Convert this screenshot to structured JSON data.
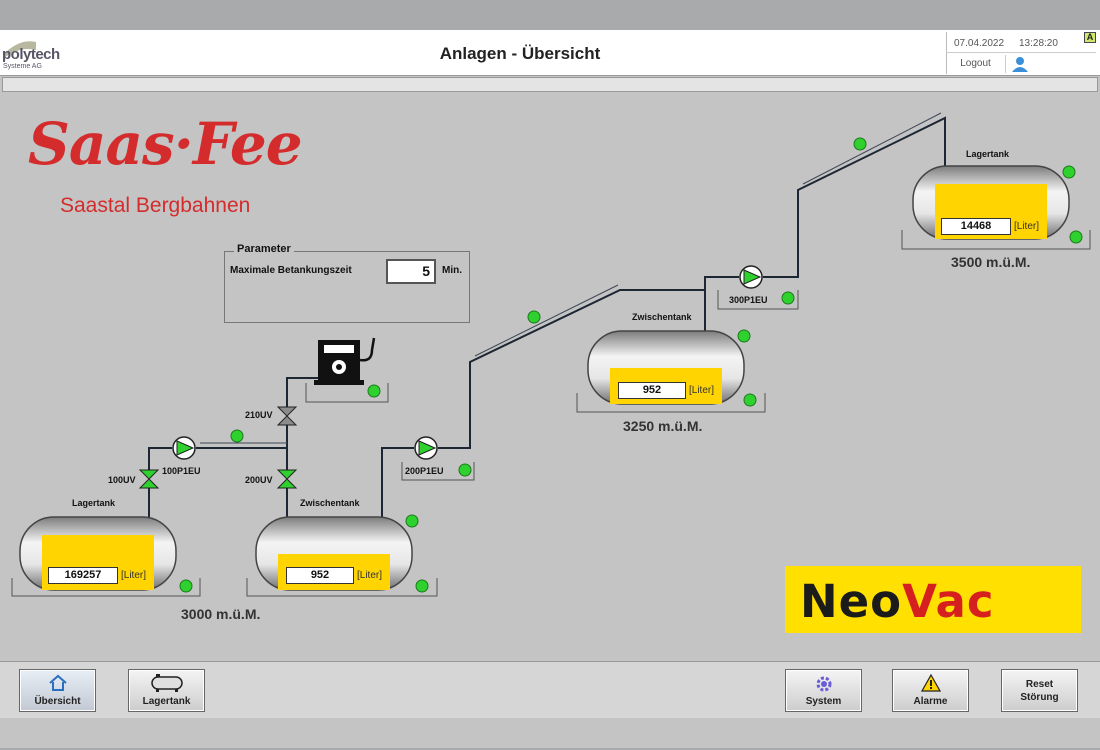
{
  "header": {
    "logo_text": "polytech",
    "logo_sub": "Systeme AG",
    "title": "Anlagen - Übersicht",
    "date": "07.04.2022",
    "time": "13:28:20",
    "badge": "A",
    "logout_label": "Logout"
  },
  "brand": {
    "saasfee": "Saas·Fee",
    "saasfee_sub": "Saastal Bergbahnen",
    "neovac_part1": "Neo",
    "neovac_part2": "Vac"
  },
  "parameter": {
    "legend": "Parameter",
    "label": "Maximale Betankungszeit",
    "value": "5",
    "unit": "Min."
  },
  "tanks": [
    {
      "name": "Lagertank",
      "value": "169257",
      "unit": "[Liter]"
    },
    {
      "name": "Zwischentank",
      "value": "952",
      "unit": "[Liter]"
    },
    {
      "name": "Zwischentank",
      "value": "952",
      "unit": "[Liter]"
    },
    {
      "name": "Lagertank",
      "value": "14468",
      "unit": "[Liter]"
    }
  ],
  "valves": {
    "v100": "100UV",
    "v200": "200UV",
    "v210": "210UV"
  },
  "pumps": {
    "p100": "100P1EU",
    "p200": "200P1EU",
    "p300": "300P1EU"
  },
  "elevations": {
    "e3000": "3000 m.ü.M.",
    "e3250": "3250 m.ü.M.",
    "e3500": "3500 m.ü.M."
  },
  "footer": {
    "overview": "Übersicht",
    "lagertank": "Lagertank",
    "system": "System",
    "alarme": "Alarme",
    "reset_line1": "Reset",
    "reset_line2": "Störung"
  },
  "colors": {
    "status_ok": "#2ed12e",
    "fill_level": "#ffd400",
    "brand_red": "#d42c2c",
    "neovac_yellow": "#ffe000"
  }
}
